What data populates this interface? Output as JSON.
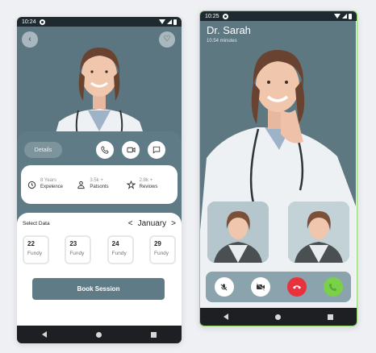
{
  "left_screen": {
    "status_time": "10:24",
    "details_label": "Details",
    "stats": [
      {
        "value": "8 Years",
        "label": "Expelence",
        "icon": "clock-icon"
      },
      {
        "value": "3.5k +",
        "label": "Patsonts",
        "icon": "person-icon"
      },
      {
        "value": "2.8k +",
        "label": "Reviows",
        "icon": "star-icon"
      }
    ],
    "select_label": "Select Data",
    "month": "January",
    "prev_glyph": "<",
    "next_glyph": ">",
    "dates": [
      {
        "day": "22",
        "sub": "Fundy"
      },
      {
        "day": "23",
        "sub": "Fundy"
      },
      {
        "day": "24",
        "sub": "Fundy"
      },
      {
        "day": "29",
        "sub": "Fundy"
      }
    ],
    "book_label": "Book Session",
    "back_glyph": "‹",
    "heart_glyph": "♡"
  },
  "right_screen": {
    "status_time": "10:25",
    "doctor_name": "Dr. Sarah",
    "duration": "10.54 minutes"
  },
  "colors": {
    "accent": "#5f7b86",
    "end_call": "#e8323e",
    "accept_call": "#7bd04a"
  }
}
